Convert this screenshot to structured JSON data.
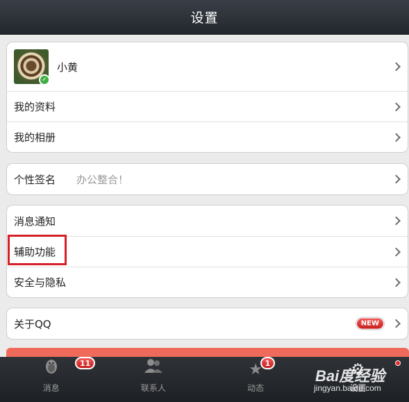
{
  "header": {
    "title": "设置"
  },
  "profile": {
    "name": "小黄",
    "verified_mark": "✓"
  },
  "group1": [
    {
      "label": "我的资料"
    },
    {
      "label": "我的相册"
    }
  ],
  "signature": {
    "label": "个性签名",
    "value": "办公整合！"
  },
  "group3": [
    {
      "label": "消息通知"
    },
    {
      "label": "辅助功能"
    },
    {
      "label": "安全与隐私"
    }
  ],
  "about": {
    "label": "关于QQ",
    "badge": "NEW"
  },
  "tabs": [
    {
      "label": "消息",
      "badge": "11",
      "icon": "penguin-icon"
    },
    {
      "label": "联系人",
      "icon": "contacts-icon"
    },
    {
      "label": "动态",
      "badge": "1",
      "icon": "star-icon"
    },
    {
      "label": "设置",
      "icon": "gear-icon"
    }
  ],
  "watermark": {
    "brand": "Bai度经验",
    "url": "jingyan.baidu.com"
  },
  "colors": {
    "highlight": "#d51f27",
    "badge_red": "#d42222",
    "header_bg": "#2a2e34"
  }
}
